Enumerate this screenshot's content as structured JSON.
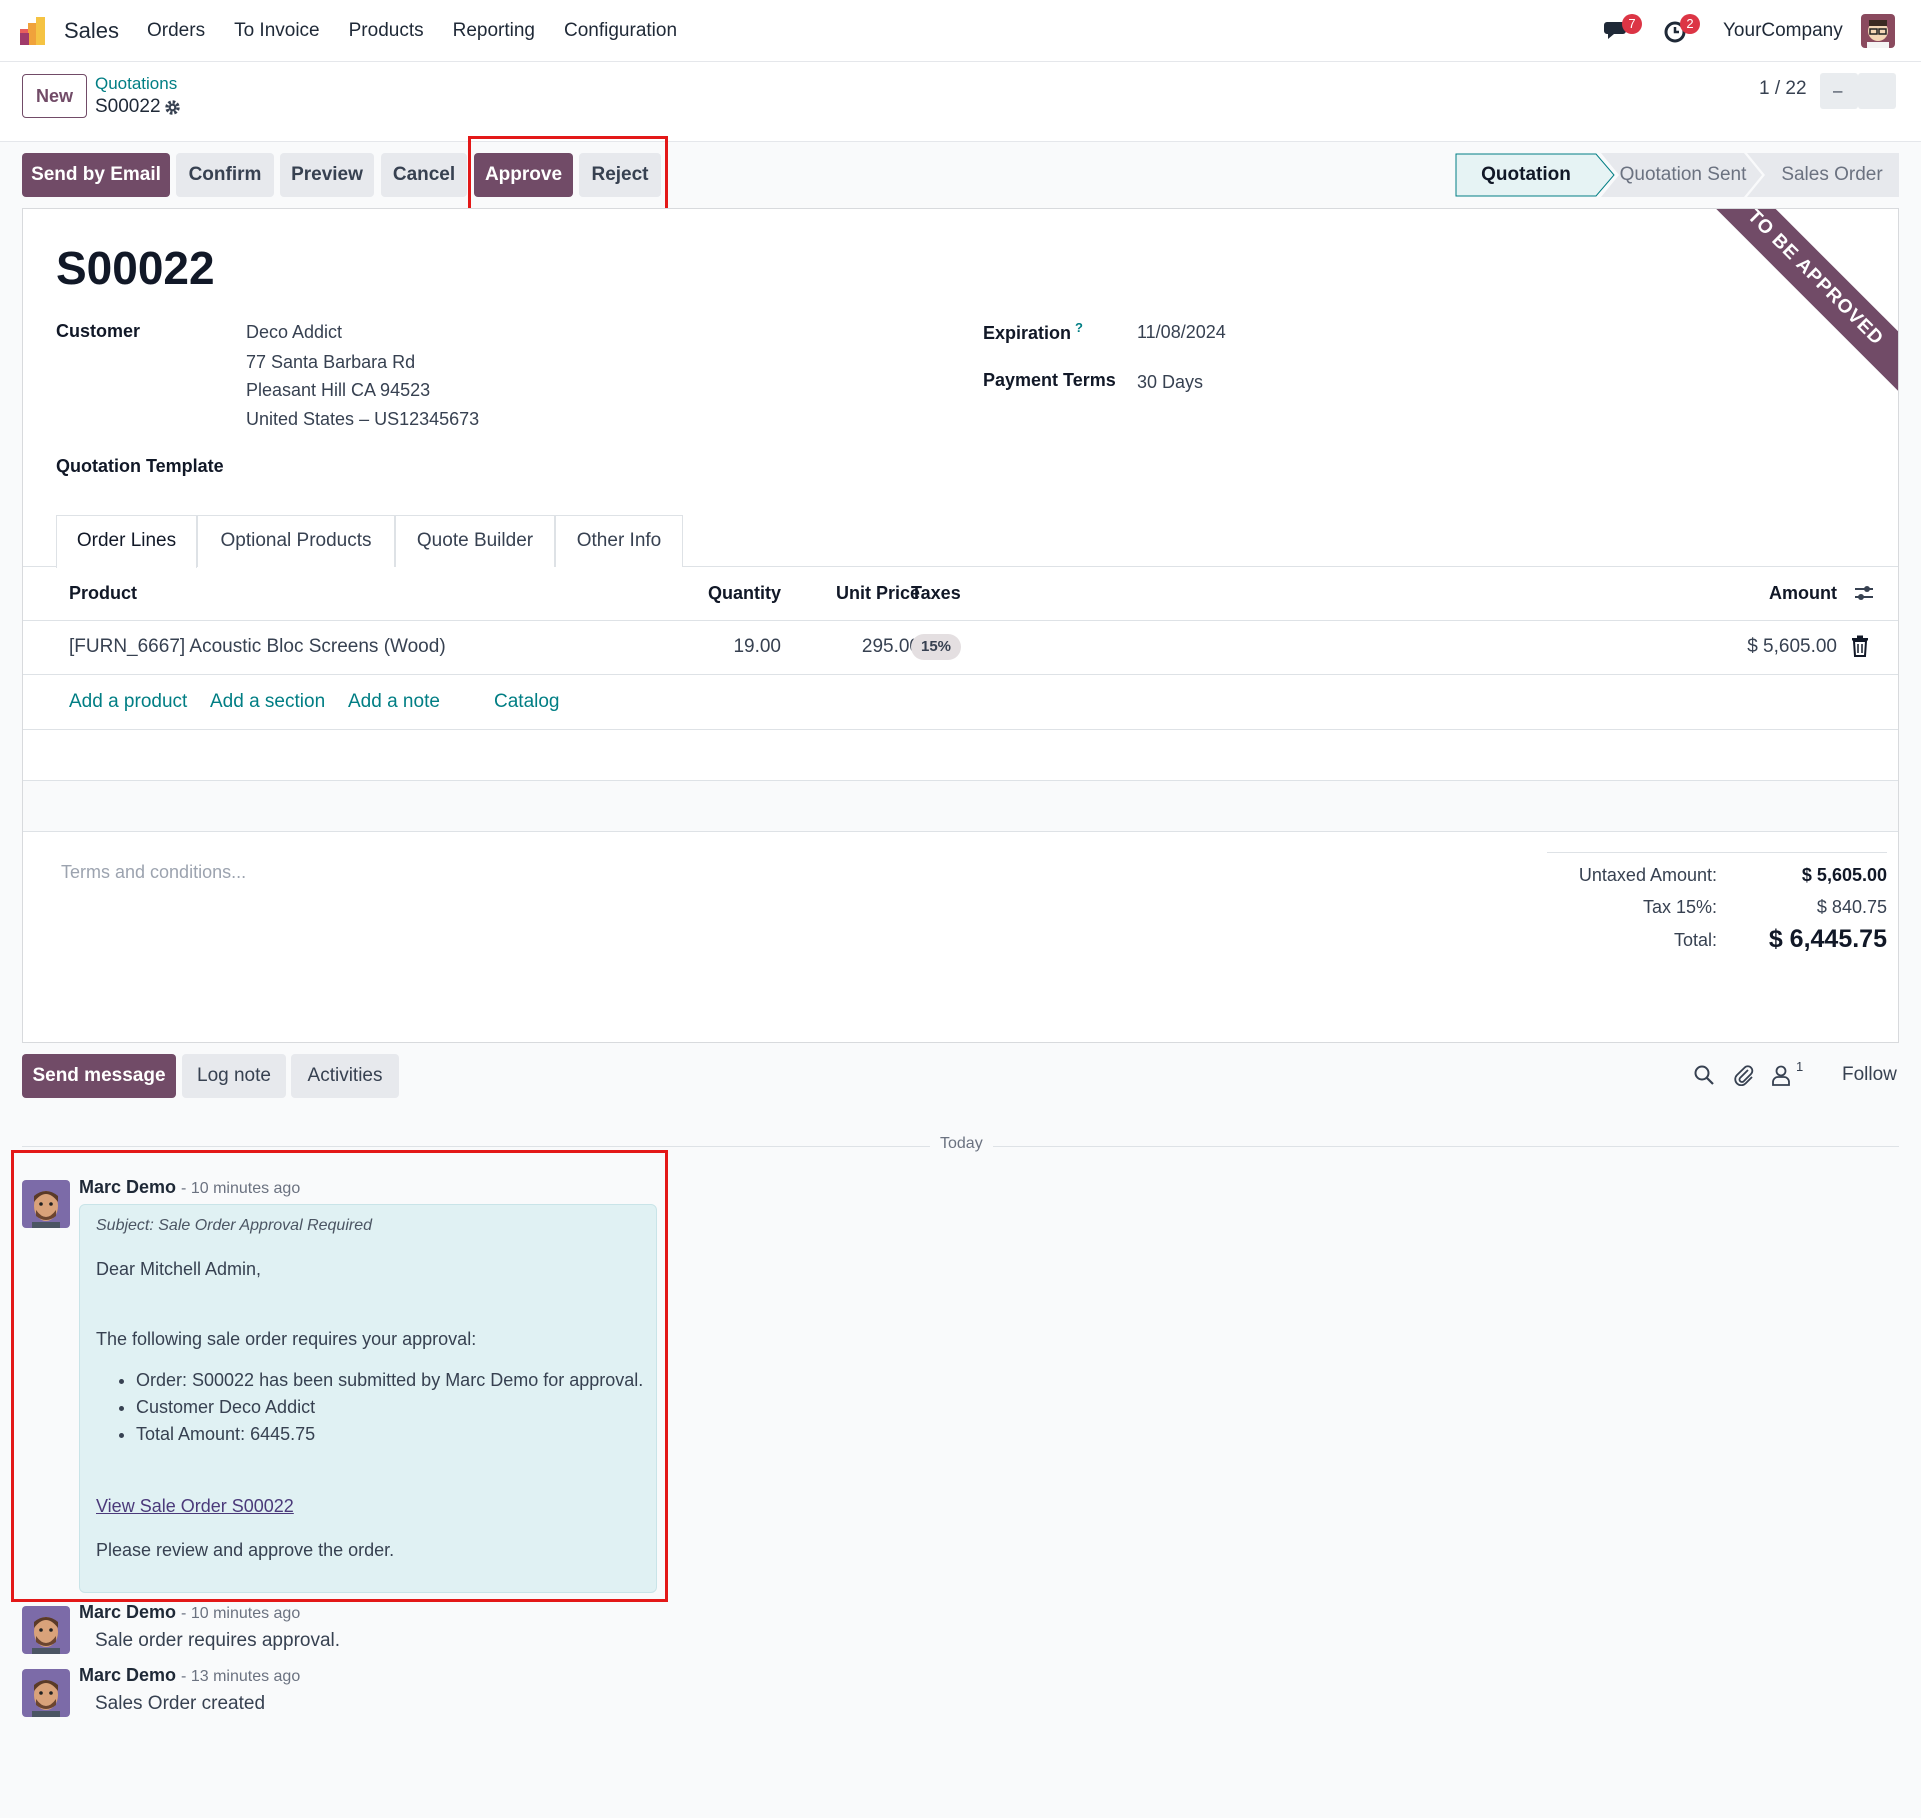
{
  "navbar": {
    "app_name": "Sales",
    "menu": [
      "Orders",
      "To Invoice",
      "Products",
      "Reporting",
      "Configuration"
    ],
    "messages_badge": "7",
    "activities_badge": "2",
    "company": "YourCompany"
  },
  "control_panel": {
    "new_label": "New",
    "breadcrumb": "Quotations",
    "record_name": "S00022",
    "pager": "1 / 22",
    "pager_prev": "–"
  },
  "actions": {
    "send_email": "Send by Email",
    "confirm": "Confirm",
    "preview": "Preview",
    "cancel": "Cancel",
    "approve": "Approve",
    "reject": "Reject"
  },
  "statusbar": [
    "Quotation",
    "Quotation Sent",
    "Sales Order"
  ],
  "form": {
    "ribbon": "TO BE APPROVED",
    "title": "S00022",
    "customer_label": "Customer",
    "customer_lines": [
      "Deco Addict",
      "77 Santa Barbara Rd",
      "Pleasant Hill CA 94523",
      "United States – US12345673"
    ],
    "expiration_label": "Expiration",
    "expiration_help": "?",
    "expiration_value": "11/08/2024",
    "payment_terms_label": "Payment Terms",
    "payment_terms_value": "30 Days",
    "template_label": "Quotation Template",
    "tabs": [
      "Order Lines",
      "Optional Products",
      "Quote Builder",
      "Other Info"
    ]
  },
  "order_lines": {
    "headers": {
      "product": "Product",
      "quantity": "Quantity",
      "unit_price": "Unit Price",
      "taxes": "Taxes",
      "amount": "Amount"
    },
    "rows": [
      {
        "product": "[FURN_6667] Acoustic Bloc Screens (Wood)",
        "quantity": "19.00",
        "unit_price": "295.00",
        "tax": "15%",
        "amount": "$ 5,605.00"
      }
    ],
    "add_links": [
      "Add a product",
      "Add a section",
      "Add a note",
      "Catalog"
    ]
  },
  "totals": {
    "terms_placeholder": "Terms and conditions...",
    "untaxed_label": "Untaxed Amount:",
    "untaxed_value": "$ 5,605.00",
    "tax_label": "Tax 15%:",
    "tax_value": "$ 840.75",
    "total_label": "Total:",
    "total_value": "$ 6,445.75"
  },
  "chatter": {
    "send_message": "Send message",
    "log_note": "Log note",
    "activities": "Activities",
    "followers_count": "1",
    "follow": "Follow",
    "today": "Today",
    "messages": [
      {
        "author": "Marc Demo",
        "time": "- 10 minutes ago",
        "subject": "Subject: Sale Order Approval Required",
        "greeting": "Dear Mitchell Admin,",
        "intro": "The following sale order requires your approval:",
        "bullets": [
          "Order: S00022 has been submitted by Marc Demo for approval.",
          "Customer Deco Addict",
          "Total Amount: 6445.75"
        ],
        "link": "View Sale Order S00022",
        "closing": "Please review and approve the order."
      },
      {
        "author": "Marc Demo",
        "time": "- 10 minutes ago",
        "body": "Sale order requires approval."
      },
      {
        "author": "Marc Demo",
        "time": "- 13 minutes ago",
        "body": "Sales Order created"
      }
    ]
  },
  "colors": {
    "brand": "#714b67",
    "link": "#017e84",
    "highlight": "#e31818",
    "bubble": "#e0f1f3"
  }
}
